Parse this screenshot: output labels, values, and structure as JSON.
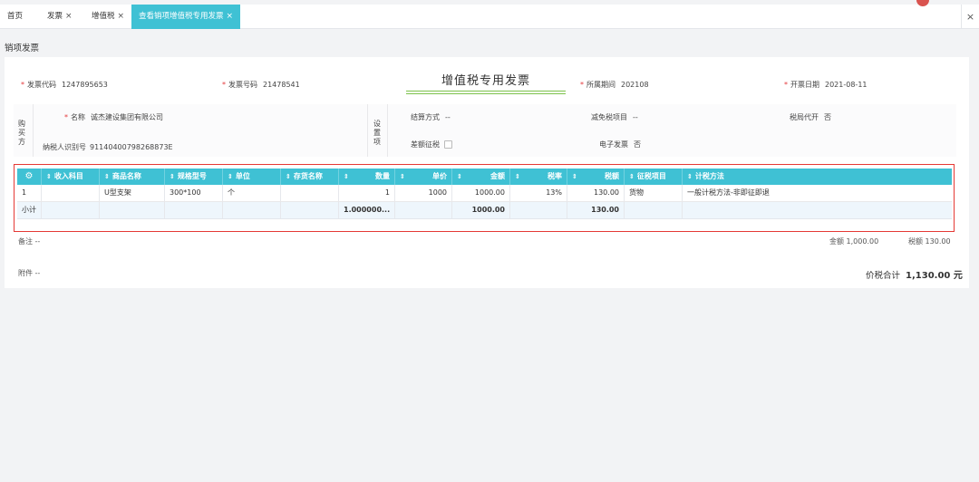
{
  "tabs": [
    {
      "label": "首页",
      "closable": false
    },
    {
      "label": "发票",
      "closable": true
    },
    {
      "label": "增值税",
      "closable": true
    },
    {
      "label": "查看销项增值税专用发票",
      "closable": true,
      "active": true
    }
  ],
  "close_symbol": "×",
  "page_title": "销项发票",
  "invoice": {
    "title": "增值税专用发票",
    "code_label": "发票代码",
    "code": "1247895653",
    "number_label": "发票号码",
    "number": "21478541",
    "period_label": "所属期间",
    "period": "202108",
    "date_label": "开票日期",
    "date": "2021-08-11"
  },
  "buyer": {
    "side_label": "购买方",
    "name_label": "名称",
    "name": "诚杰建设集团有限公司",
    "taxid_label": "纳税人识别号",
    "taxid": "91140400798268873E"
  },
  "settings": {
    "side_label": "设置项",
    "settle_label": "结算方式",
    "settle": "--",
    "exempt_label": "减免税项目",
    "exempt": "--",
    "agent_label": "税局代开",
    "agent": "否",
    "diff_tax_label": "差额征税",
    "e_invoice_label": "电子发票",
    "e_invoice": "否"
  },
  "table": {
    "headers": [
      "收入科目",
      "商品名称",
      "规格型号",
      "单位",
      "存货名称",
      "数量",
      "单价",
      "金额",
      "税率",
      "税额",
      "征税项目",
      "计税方法"
    ],
    "rows": [
      {
        "idx": "1",
        "subject": "",
        "goods": "U型支架",
        "spec": "300*100",
        "unit": "个",
        "stock": "",
        "qty": "1",
        "price": "1000",
        "amount": "1000.00",
        "rate": "13%",
        "tax": "130.00",
        "item": "货物",
        "method": "一般计税方法-非即征即退"
      }
    ],
    "subtotal": {
      "label": "小计",
      "qty": "1.000000...",
      "amount": "1000.00",
      "tax": "130.00"
    }
  },
  "remark_label": "备注",
  "remark": "--",
  "attach_label": "附件",
  "attach": "--",
  "amount_label": "金额",
  "amount": "1,000.00",
  "tax_label": "税额",
  "tax": "130.00",
  "total_label": "价税合计",
  "total": "1,130.00 元"
}
